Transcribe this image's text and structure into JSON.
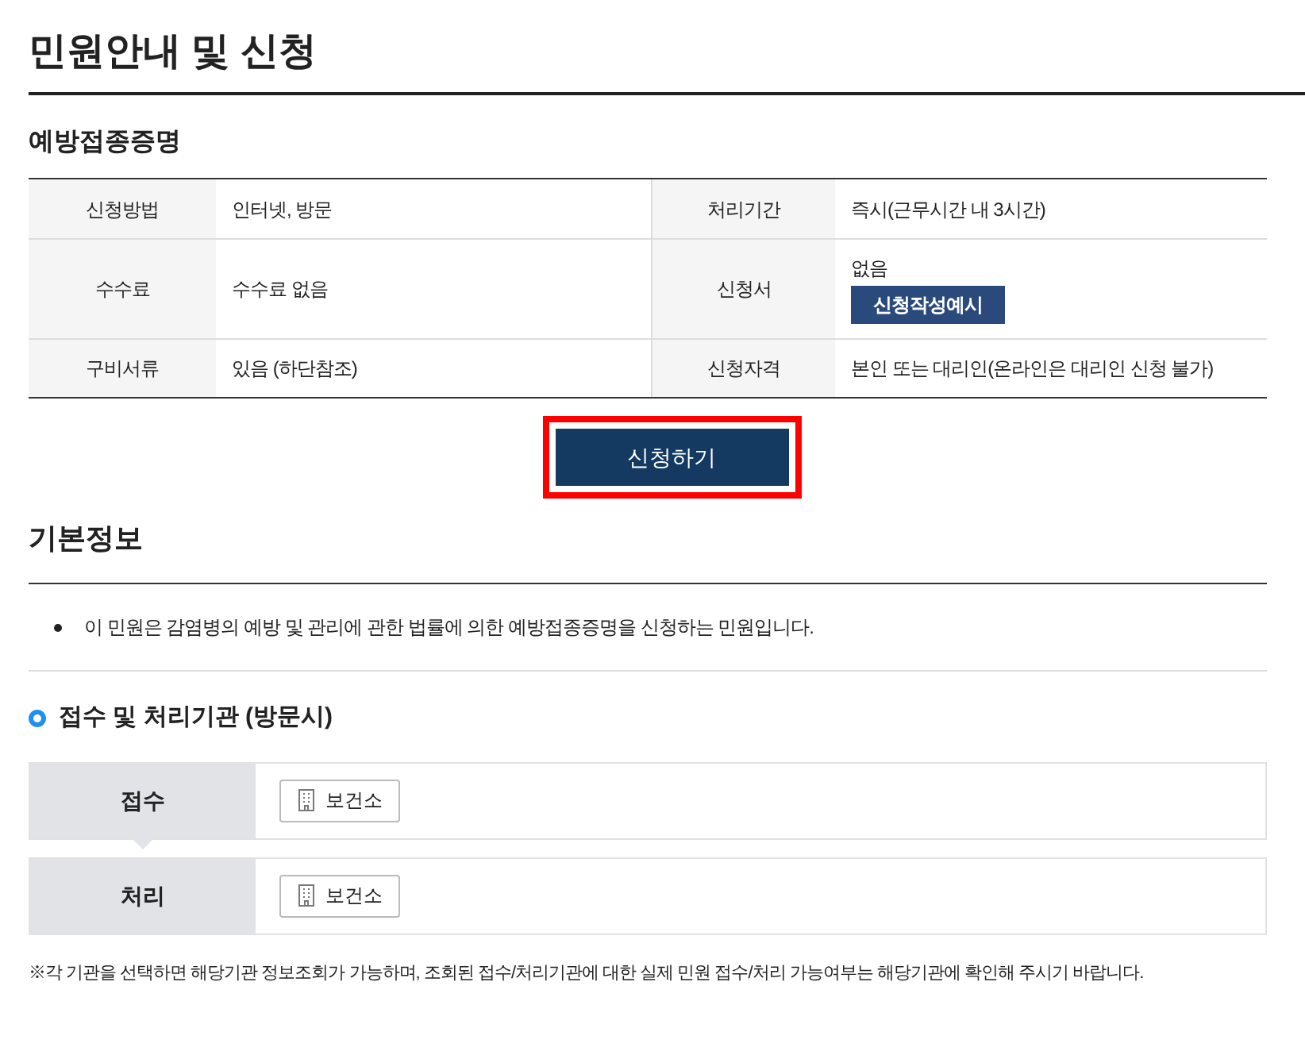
{
  "title": "민원안내 및 신청",
  "section_title": "예방접종증명",
  "info_rows": [
    {
      "cells": [
        {
          "label": "신청방법",
          "value": "인터넷, 방문"
        },
        {
          "label": "처리기간",
          "value": "즉시(근무시간 내 3시간)"
        }
      ]
    },
    {
      "cells": [
        {
          "label": "수수료",
          "value": "수수료 없음"
        },
        {
          "label": "신청서",
          "value": "없음",
          "button": "신청작성예시"
        }
      ]
    },
    {
      "cells": [
        {
          "label": "구비서류",
          "value": "있음 (하단참조)"
        },
        {
          "label": "신청자격",
          "value": "본인 또는 대리인(온라인은 대리인 신청 불가)"
        }
      ]
    }
  ],
  "apply_button": "신청하기",
  "basic_info": {
    "title": "기본정보",
    "bullets": [
      "이 민원은 감염병의 예방 및 관리에 관한 법률에 의한 예방접종증명을 신청하는 민원입니다."
    ]
  },
  "agencies": {
    "title": "접수 및 처리기관 (방문시)",
    "rows": [
      {
        "label": "접수",
        "office": "보건소"
      },
      {
        "label": "처리",
        "office": "보건소"
      }
    ]
  },
  "note": "※각 기관을 선택하면 해당기관 정보조회가 가능하며, 조회된 접수/처리기관에 대한 실제 민원 접수/처리 가능여부는 해당기관에 확인해 주시기 바랍니다."
}
